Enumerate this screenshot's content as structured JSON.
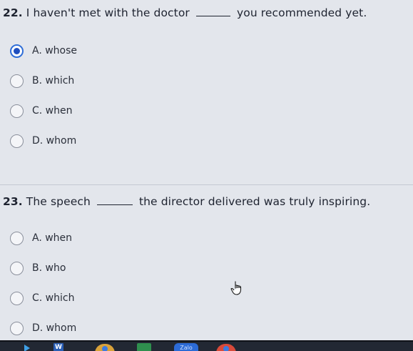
{
  "questions": [
    {
      "number": "22.",
      "before": "I haven't met with the doctor",
      "after": "you recommended yet.",
      "options": [
        {
          "label": "A. whose",
          "selected": true
        },
        {
          "label": "B. which",
          "selected": false
        },
        {
          "label": "C. when",
          "selected": false
        },
        {
          "label": "D. whom",
          "selected": false
        }
      ]
    },
    {
      "number": "23.",
      "before": "The speech",
      "after": "the director delivered was truly inspiring.",
      "options": [
        {
          "label": "A. when",
          "selected": false
        },
        {
          "label": "B. who",
          "selected": false
        },
        {
          "label": "C. which",
          "selected": false
        },
        {
          "label": "D. whom",
          "selected": false
        }
      ]
    }
  ],
  "taskbar": {
    "word_label": "W",
    "zalo_label": "Zalo",
    "icons": [
      "start-icon",
      "word-icon",
      "chrome-icon",
      "excel-icon",
      "zalo-icon",
      "chrome-icon"
    ]
  },
  "colors": {
    "background": "#e3e6ec",
    "selected_radio": "#2f6ed8",
    "text": "#1e2330"
  }
}
